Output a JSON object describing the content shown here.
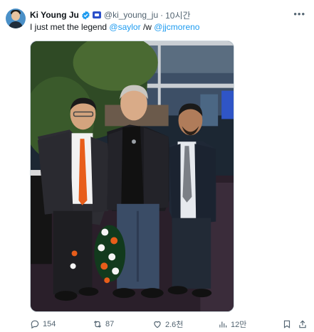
{
  "tweet": {
    "author_name": "Ki Young Ju",
    "handle": "@ki_young_ju",
    "separator": "·",
    "time": "10시간",
    "text_prefix": "I just met the legend ",
    "mention_1": "@saylor",
    "text_middle": " /w ",
    "mention_2": "@jjcmoreno"
  },
  "actions": {
    "replies": "154",
    "reposts": "87",
    "likes": "2.6천",
    "views": "12만"
  },
  "colors": {
    "accent": "#1d9bf0",
    "text": "#0f1419",
    "secondary": "#536471"
  },
  "icons": [
    "verified-badge-icon",
    "flag-badge-icon",
    "more-icon",
    "reply-icon",
    "repost-icon",
    "like-icon",
    "views-icon",
    "bookmark-icon",
    "share-icon"
  ]
}
